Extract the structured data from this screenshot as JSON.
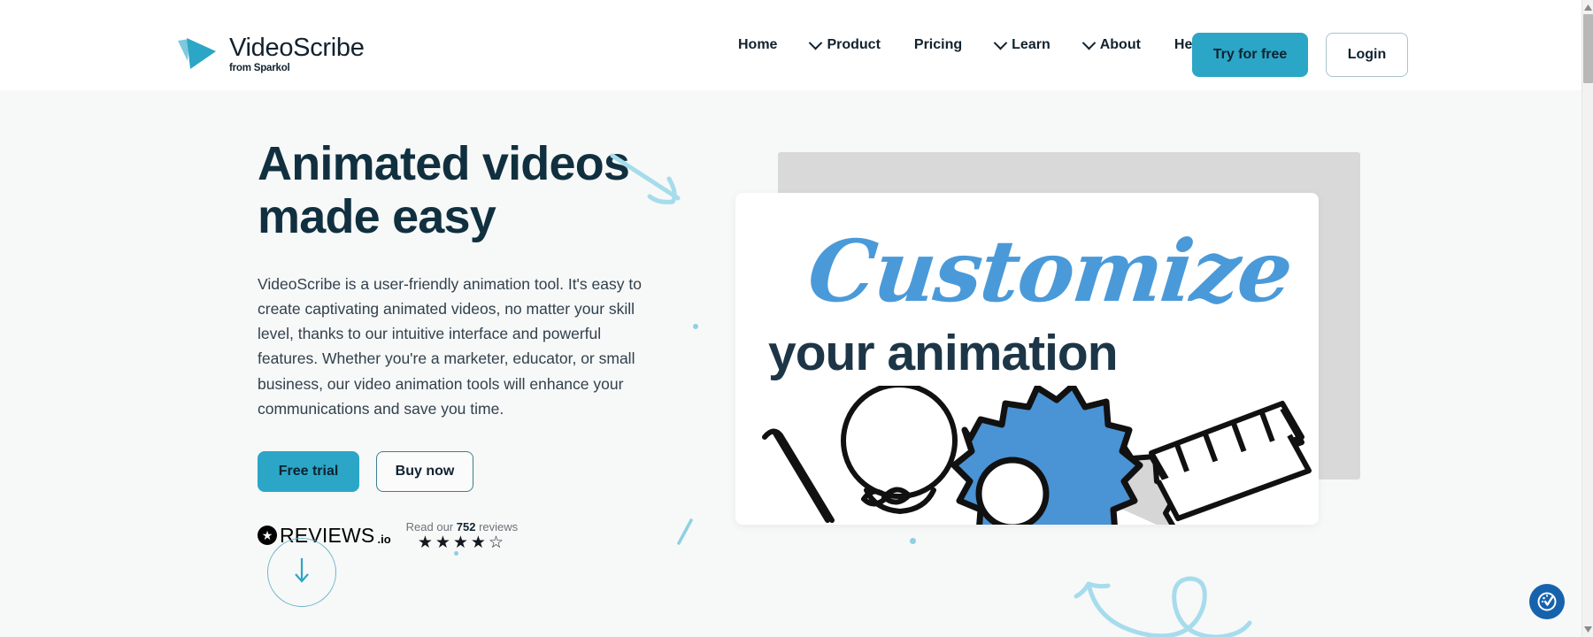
{
  "brand": {
    "name": "VideoScribe",
    "tagline": "from Sparkol",
    "logo_icon": "play-triangle-icon",
    "accent_color": "#2ba6c6",
    "dark_color": "#12222e"
  },
  "nav": {
    "items": [
      {
        "label": "Home",
        "has_dropdown": false,
        "icon": ""
      },
      {
        "label": "Product",
        "has_dropdown": true,
        "icon": "chevron-down-icon"
      },
      {
        "label": "Pricing",
        "has_dropdown": false,
        "icon": ""
      },
      {
        "label": "Learn",
        "has_dropdown": true,
        "icon": "chevron-down-icon"
      },
      {
        "label": "About",
        "has_dropdown": true,
        "icon": "chevron-down-icon"
      },
      {
        "label": "Help",
        "has_dropdown": false,
        "icon": ""
      }
    ],
    "try_button": "Try for free",
    "login_button": "Login"
  },
  "hero": {
    "headline_line1": "Animated videos",
    "headline_line2": "made easy",
    "paragraph": "VideoScribe is a user-friendly animation tool. It's easy to create captivating animated videos, no matter your skill level, thanks to our intuitive interface and powerful features. Whether you're a marketer, educator, or small business, our video animation tools will enhance your communications and save you time.",
    "primary_cta": "Free trial",
    "secondary_cta": "Buy now",
    "scroll_icon": "arrow-down-icon"
  },
  "reviews": {
    "logo_word": "REVIEWS",
    "logo_suffix": ".io",
    "logo_icon": "star-badge-icon",
    "read_prefix": "Read our",
    "count": "752",
    "read_suffix": "reviews",
    "stars": "★★★★",
    "half_star": "★",
    "rating": 4.5
  },
  "hero_image": {
    "script_word": "Customize",
    "bold_word": "your animation",
    "illustration": "doodle-gears-lightbulb-clapperboard",
    "script_color": "#4a9ad9",
    "bold_color": "#1d3647"
  },
  "decorations": {
    "arrow_top": "hand-drawn-arrow-down-right",
    "arrow_bottom": "hand-drawn-curved-arrow-loop",
    "dot": "decorative-dot",
    "slash": "decorative-slash"
  },
  "widgets": {
    "cookie_badge": "cookie-consent-icon"
  },
  "scrollbar": {
    "up_arrow": "scroll-up-arrow-icon",
    "down_arrow": "scroll-down-arrow-icon"
  }
}
